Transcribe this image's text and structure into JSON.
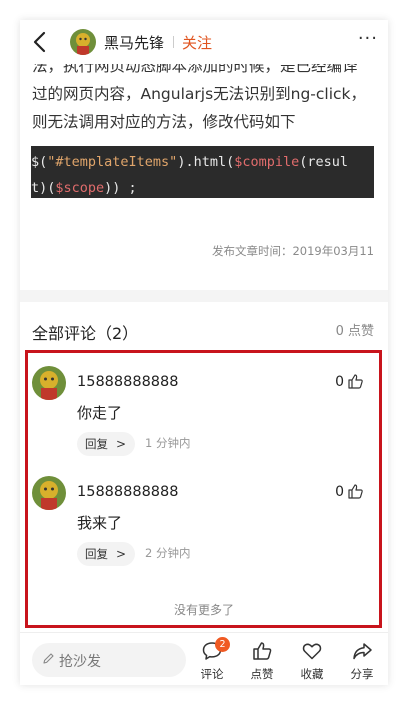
{
  "header": {
    "author_name": "黑马先锋",
    "follow_label": "关注",
    "more_label": "···"
  },
  "article": {
    "lines": [
      "法，执行网页动态脚本添加的时候，是已经编译",
      "过的网页内容，Angularjs无法识别到ng-click，",
      "则无法调用对应的方法，修改代码如下"
    ],
    "code": {
      "line1": [
        "$(",
        "\"#templateItems\"",
        ").html(",
        "$compile",
        "(resul"
      ],
      "line2": [
        "t)(",
        "$scope",
        ")) ;"
      ]
    },
    "publish_date": "发布文章时间：2019年03月11"
  },
  "comments_section": {
    "title": "全部评论（2）",
    "likes_total": "0 点赞",
    "comments": [
      {
        "user": "15888888888",
        "text": "你走了",
        "like_count": "0",
        "reply_label": "回复",
        "time": "1 分钟内"
      },
      {
        "user": "15888888888",
        "text": "我来了",
        "like_count": "0",
        "reply_label": "回复",
        "time": "2 分钟内"
      }
    ],
    "no_more": "没有更多了",
    "highlight_color": "#c8141c"
  },
  "bottom_bar": {
    "input_placeholder": "抢沙发",
    "comment_label": "评论",
    "comment_badge": "2",
    "like_label": "点赞",
    "favorite_label": "收藏",
    "share_label": "分享"
  },
  "colors": {
    "accent": "#e0541f",
    "badge": "#f05a23",
    "code_bg": "#2b2b2b",
    "code_string": "#e0a56b",
    "code_variable": "#e06c6c"
  }
}
